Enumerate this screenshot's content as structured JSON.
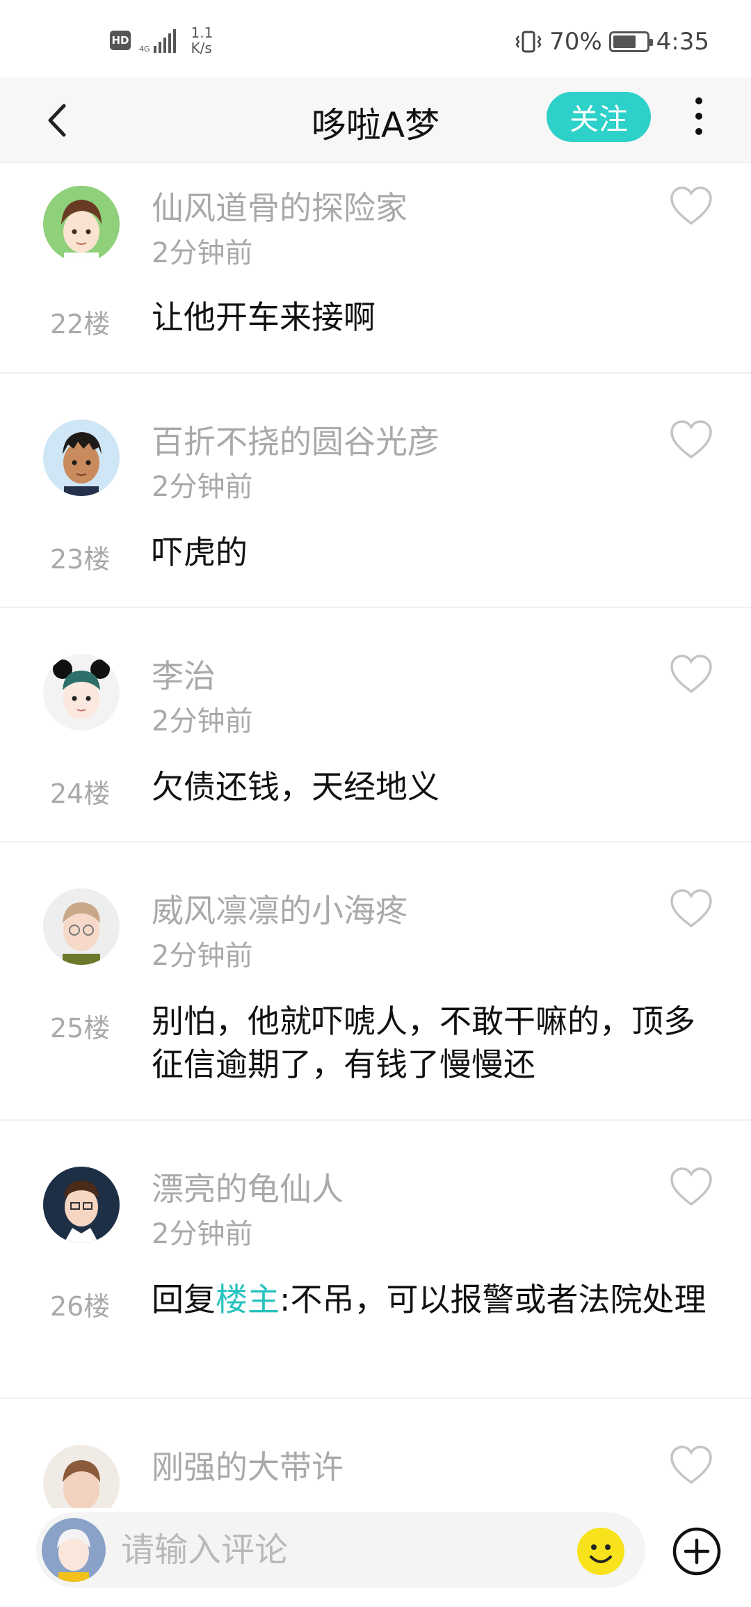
{
  "status_bar": {
    "hd": "HD",
    "network": "4G",
    "speed_value": "1.1",
    "speed_unit": "K/s",
    "battery_percent_text": "70%",
    "battery_level": 0.7,
    "time": "4:35"
  },
  "header": {
    "title": "哆啦A梦",
    "follow_label": "关注",
    "accent_color": "#2dd1c9"
  },
  "comments": [
    {
      "name": "仙风道骨的探险家",
      "time": "2分钟前",
      "floor": "22楼",
      "text": "让他开车来接啊",
      "avatar_icon": "boy-avatar-green"
    },
    {
      "name": "百折不挠的圆谷光彦",
      "time": "2分钟前",
      "floor": "23楼",
      "text": "吓虎的",
      "avatar_icon": "boy-avatar-blue"
    },
    {
      "name": "李治",
      "time": "2分钟前",
      "floor": "24楼",
      "text": "欠债还钱，天经地义",
      "avatar_icon": "girl-avatar-bear-ears"
    },
    {
      "name": "威风凛凛的小海疼",
      "time": "2分钟前",
      "floor": "25楼",
      "text": "别怕，他就吓唬人，不敢干嘛的，顶多征信逾期了，有钱了慢慢还",
      "avatar_icon": "man-avatar-glasses"
    },
    {
      "name": "漂亮的龟仙人",
      "time": "2分钟前",
      "floor": "26楼",
      "text_prefix": "回复",
      "mention": "楼主",
      "text_suffix": ":不吊，可以报警或者法院处理",
      "avatar_icon": "man-avatar-navy"
    },
    {
      "name": "刚强的大带许",
      "avatar_icon": "man-avatar-partial"
    }
  ],
  "bottom_bar": {
    "placeholder": "请输入评论"
  }
}
